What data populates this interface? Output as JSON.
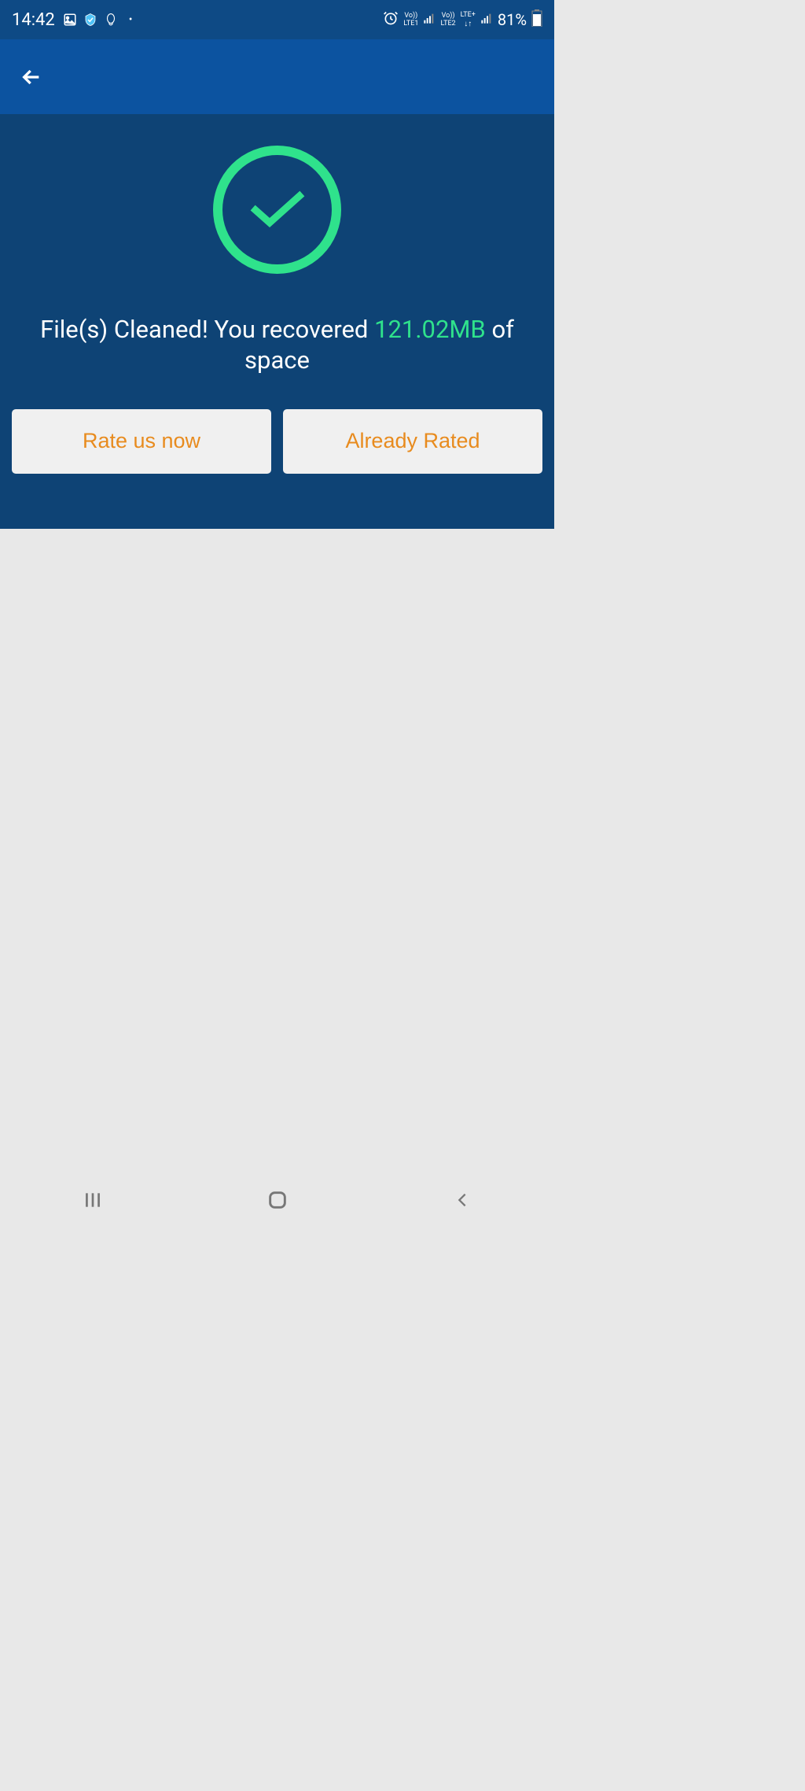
{
  "status_bar": {
    "time": "14:42",
    "battery_percent": "81%",
    "lte1_label": "LTE1",
    "lte2_label": "LTE2",
    "vo1": "Vo))",
    "vo2": "Vo))",
    "lte_plus": "LTE+"
  },
  "main": {
    "message_part1": "File(s) Cleaned! You recovered ",
    "recovered_size": "121.02MB",
    "message_part2": " of space"
  },
  "buttons": {
    "rate_us": "Rate us now",
    "already_rated": "Already Rated"
  }
}
